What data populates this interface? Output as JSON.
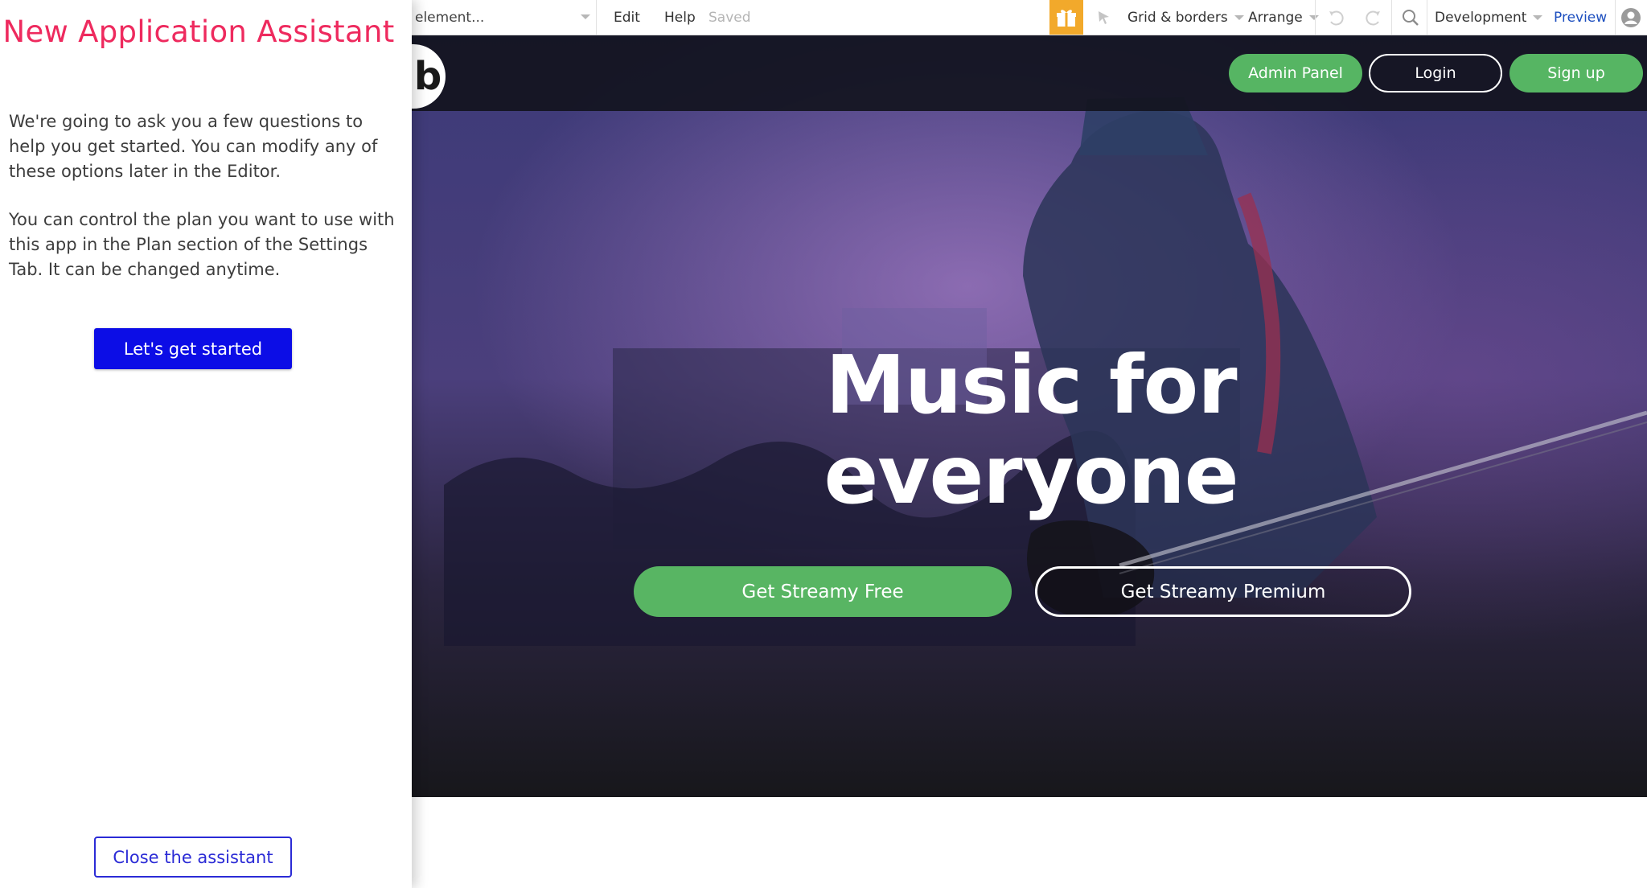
{
  "assistant": {
    "title": "New Application Assistant",
    "intro": "We're going to ask you a few questions to help you get started. You can modify any of these options later in the Editor.",
    "plan_note": "You can control the plan you want to use with this app in the Plan section of the Settings Tab. It can be changed anytime.",
    "start_label": "Let's get started",
    "close_label": "Close the assistant"
  },
  "toolbar": {
    "element_search": "element...",
    "edit": "Edit",
    "help": "Help",
    "status": "Saved",
    "gift_icon": "gift-icon",
    "grid": "Grid & borders",
    "arrange": "Arrange",
    "environment": "Development",
    "preview": "Preview"
  },
  "site": {
    "logo_letter": "b",
    "nav": {
      "admin": "Admin Panel",
      "login": "Login",
      "signup": "Sign up"
    },
    "headline_line1": "Music for",
    "headline_line2": "everyone",
    "cta_free": "Get Streamy Free",
    "cta_premium": "Get Streamy Premium"
  },
  "colors": {
    "assistant_title": "#ee2a5e",
    "primary_button": "#0c0de6",
    "nav_green": "#56b563",
    "gift_orange": "#f2a92b",
    "preview_link": "#1d4fbf"
  }
}
